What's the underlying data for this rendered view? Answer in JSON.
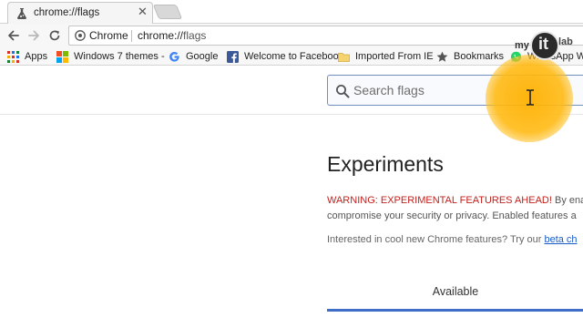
{
  "browser": {
    "tab": {
      "title": "chrome://flags",
      "close_glyph": "✕",
      "favicon": "flask-icon"
    },
    "toolbar": {
      "scheme_chip": "Chrome",
      "url_host": "chrome://",
      "url_path": "flags",
      "icons": [
        "back-arrow-icon",
        "forward-arrow-icon",
        "reload-icon",
        "secure-icon"
      ]
    },
    "bookmarks": [
      {
        "label": "Apps",
        "icon": "apps-grid-icon"
      },
      {
        "label": "Windows 7 themes -",
        "icon": "windows-logo-icon"
      },
      {
        "label": "Google",
        "icon": "google-g-icon"
      },
      {
        "label": "Welcome to Faceboo",
        "icon": "facebook-icon"
      },
      {
        "label": "Imported From IE",
        "icon": "folder-icon"
      },
      {
        "label": "Bookmarks",
        "icon": "star-icon"
      },
      {
        "label": "WhatsApp We",
        "icon": "whatsapp-icon"
      }
    ]
  },
  "page": {
    "search": {
      "placeholder": "Search flags",
      "value": ""
    },
    "title": "Experiments",
    "warning_red": "WARNING: EXPERIMENTAL FEATURES AHEAD!",
    "warning_rest": " By enab",
    "warning_line2": "compromise your security or privacy. Enabled features a",
    "promo_text": "Interested in cool new Chrome features? Try our ",
    "promo_link": "beta ch",
    "tab_available": "Available"
  },
  "watermark": {
    "my": "my",
    "it": "it",
    "lab": "lab"
  },
  "colors": {
    "warning": "#c5201c",
    "link": "#1a5dc4",
    "accent": "#3f6ec8",
    "highlight": "#ffb000"
  }
}
